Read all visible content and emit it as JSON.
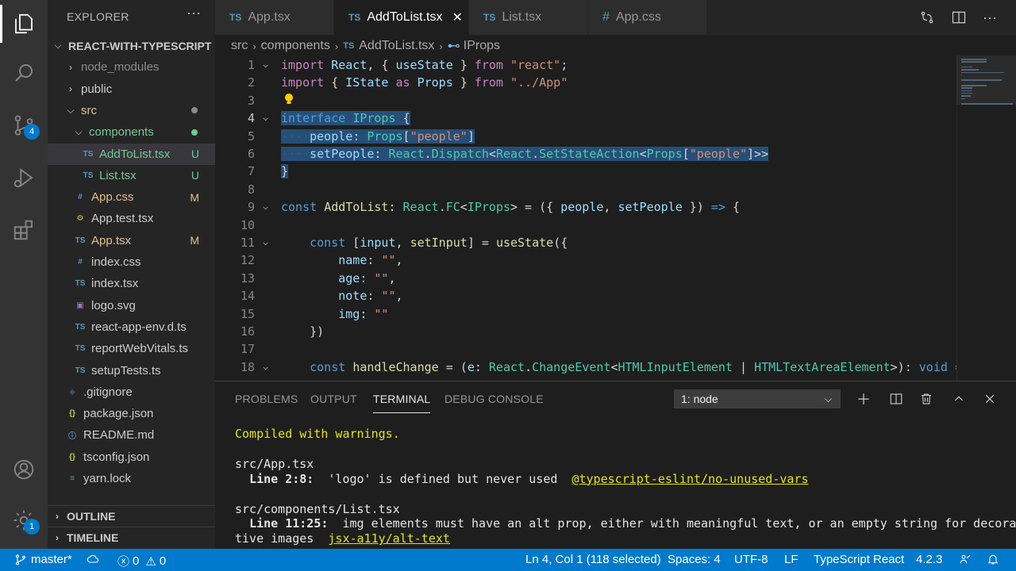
{
  "sidebar": {
    "title": "EXPLORER",
    "more": "···",
    "tree": [
      {
        "label": "REACT-WITH-TYPESCRIPT",
        "kind": "root",
        "chev": "⌵",
        "color": "#cccccc"
      },
      {
        "label": "node_modules",
        "kind": "folder",
        "chev": "›",
        "color": "#8c8c8c"
      },
      {
        "label": "public",
        "kind": "folder",
        "chev": "›",
        "color": "#cccccc"
      },
      {
        "label": "src",
        "kind": "folder",
        "chev": "⌵",
        "color": "#e2c08d",
        "dot": "#8c8c8c"
      },
      {
        "label": "components",
        "kind": "folder",
        "chev": "⌵",
        "color": "#73c991",
        "dot": "#73c991"
      },
      {
        "label": "AddToList.tsx",
        "kind": "ts",
        "color": "#73c991",
        "deco": "U",
        "selected": true
      },
      {
        "label": "List.tsx",
        "kind": "ts",
        "color": "#73c991",
        "deco": "U"
      },
      {
        "label": "App.css",
        "kind": "css",
        "color": "#e2c08d",
        "deco": "M"
      },
      {
        "label": "App.test.tsx",
        "kind": "gear",
        "color": "#cccccc"
      },
      {
        "label": "App.tsx",
        "kind": "ts",
        "color": "#e2c08d",
        "deco": "M"
      },
      {
        "label": "index.css",
        "kind": "css",
        "color": "#cccccc"
      },
      {
        "label": "index.tsx",
        "kind": "ts",
        "color": "#cccccc"
      },
      {
        "label": "logo.svg",
        "kind": "svg",
        "color": "#cccccc"
      },
      {
        "label": "react-app-env.d.ts",
        "kind": "ts",
        "color": "#cccccc"
      },
      {
        "label": "reportWebVitals.ts",
        "kind": "ts",
        "color": "#cccccc"
      },
      {
        "label": "setupTests.ts",
        "kind": "ts",
        "color": "#cccccc"
      },
      {
        "label": ".gitignore",
        "kind": "git",
        "color": "#cccccc"
      },
      {
        "label": "package.json",
        "kind": "json",
        "color": "#cccccc"
      },
      {
        "label": "README.md",
        "kind": "info",
        "color": "#cccccc"
      },
      {
        "label": "tsconfig.json",
        "kind": "json",
        "color": "#cccccc"
      },
      {
        "label": "yarn.lock",
        "kind": "lock",
        "color": "#cccccc"
      }
    ],
    "outline": "OUTLINE",
    "timeline": "TIMELINE"
  },
  "activity": {
    "scm_badge": "4",
    "settings_badge": "1"
  },
  "tabs": [
    {
      "label": "App.tsx",
      "icon": "TS",
      "active": false
    },
    {
      "label": "AddToList.tsx",
      "icon": "TS",
      "active": true,
      "close": "✕"
    },
    {
      "label": "List.tsx",
      "icon": "TS",
      "active": false
    },
    {
      "label": "App.css",
      "icon": "#",
      "active": false
    }
  ],
  "breadcrumb": {
    "parts": [
      "src",
      "components",
      "AddToList.tsx",
      "IProps"
    ],
    "file_icon": "TS",
    "symbol_icon": "⊷"
  },
  "editor": {
    "lines": [
      {
        "n": "1",
        "fold": "⌵",
        "html": "<span class='c'>import</span> <span class='v'>React</span>, { <span class='v'>useState</span> } <span class='c'>from</span> <span class='s'>\"react\"</span>;"
      },
      {
        "n": "2",
        "fold": "",
        "html": "<span class='c'>import</span> { <span class='v'>IState</span> <span class='c'>as</span> <span class='v'>Props</span> } <span class='c'>from</span> <span class='s'>\"../App\"</span>"
      },
      {
        "n": "3",
        "fold": "",
        "html": ""
      },
      {
        "n": "4",
        "fold": "⌵",
        "html": "<span class='sel'><span class='k'>interface</span> <span class='t'>IProps</span> {</span>"
      },
      {
        "n": "5",
        "fold": "",
        "html": "<span class='sel'><span class='ws'>····</span><span class='v'>people</span>: <span class='t'>Props</span>[<span class='s'>\"people\"</span>]</span>"
      },
      {
        "n": "6",
        "fold": "",
        "html": "<span class='sel'><span class='ws'>····</span><span class='v'>setPeople</span>: <span class='t'>React</span>.<span class='t'>Dispatch</span>&lt;<span class='t'>React</span>.<span class='t'>SetStateAction</span>&lt;<span class='t'>Props</span>[<span class='s'>\"people\"</span>]&gt;&gt;</span>"
      },
      {
        "n": "7",
        "fold": "",
        "html": "<span class='sel'>}</span>"
      },
      {
        "n": "8",
        "fold": "",
        "html": ""
      },
      {
        "n": "9",
        "fold": "⌵",
        "html": "<span class='k'>const</span> <span class='f'>AddToList</span>: <span class='t'>React</span>.<span class='t'>FC</span>&lt;<span class='t'>IProps</span>&gt; = ({ <span class='v'>people</span>, <span class='v'>setPeople</span> }) <span class='k'>=&gt;</span> {"
      },
      {
        "n": "10",
        "fold": "",
        "html": ""
      },
      {
        "n": "11",
        "fold": "⌵",
        "html": "    <span class='k'>const</span> [<span class='v'>input</span>, <span class='f'>setInput</span>] = <span class='f'>useState</span>({"
      },
      {
        "n": "12",
        "fold": "",
        "html": "        <span class='v'>name</span>: <span class='s'>\"\"</span>,"
      },
      {
        "n": "13",
        "fold": "",
        "html": "        <span class='v'>age</span>: <span class='s'>\"\"</span>,"
      },
      {
        "n": "14",
        "fold": "",
        "html": "        <span class='v'>note</span>: <span class='s'>\"\"</span>,"
      },
      {
        "n": "15",
        "fold": "",
        "html": "        <span class='v'>img</span>: <span class='s'>\"\"</span>"
      },
      {
        "n": "16",
        "fold": "",
        "html": "    })"
      },
      {
        "n": "17",
        "fold": "",
        "html": ""
      },
      {
        "n": "18",
        "fold": "⌵",
        "html": "    <span class='k'>const</span> <span class='f'>handleChange</span> = (<span class='v'>e</span>: <span class='t'>React</span>.<span class='t'>ChangeEvent</span>&lt;<span class='t'>HTMLInputElement</span> | <span class='t'>HTMLTextAreaElement</span>&gt;): <span class='k'>void</span> <span class='k'>=</span>"
      }
    ]
  },
  "panel": {
    "tabs": [
      {
        "label": "PROBLEMS",
        "active": false
      },
      {
        "label": "OUTPUT",
        "active": false
      },
      {
        "label": "TERMINAL",
        "active": true
      },
      {
        "label": "DEBUG CONSOLE",
        "active": false
      }
    ],
    "terminal_select": "1: node",
    "terminal": [
      {
        "text": "Compiled with warnings.",
        "style": "yellow"
      },
      {
        "text": "",
        "style": ""
      },
      {
        "text": "src/App.tsx",
        "style": ""
      },
      {
        "pre": "  ",
        "bold": "Line 2:8:",
        "mid": "  'logo' is defined but never used  ",
        "rule": "@typescript-eslint/no-unused-vars"
      },
      {
        "text": "",
        "style": ""
      },
      {
        "text": "src/components/List.tsx",
        "style": ""
      },
      {
        "pre": "  ",
        "bold": "Line 11:25:",
        "mid": "  img elements must have an alt prop, either with meaningful text, or an empty string for decora",
        "rule": ""
      },
      {
        "pre": "",
        "bold": "",
        "mid": "tive images  ",
        "rule": "jsx-a11y/alt-text"
      }
    ]
  },
  "status": {
    "branch": "master*",
    "errors": "0",
    "warnings": "0",
    "position": "Ln 4, Col 1 (118 selected)",
    "spaces": "Spaces: 4",
    "encoding": "UTF-8",
    "eol": "LF",
    "language": "TypeScript React",
    "version": "4.2.3"
  },
  "colors": {
    "accent": "#007acc",
    "untracked": "#73c991",
    "modified": "#e2c08d",
    "ts_icon": "#519aba"
  }
}
